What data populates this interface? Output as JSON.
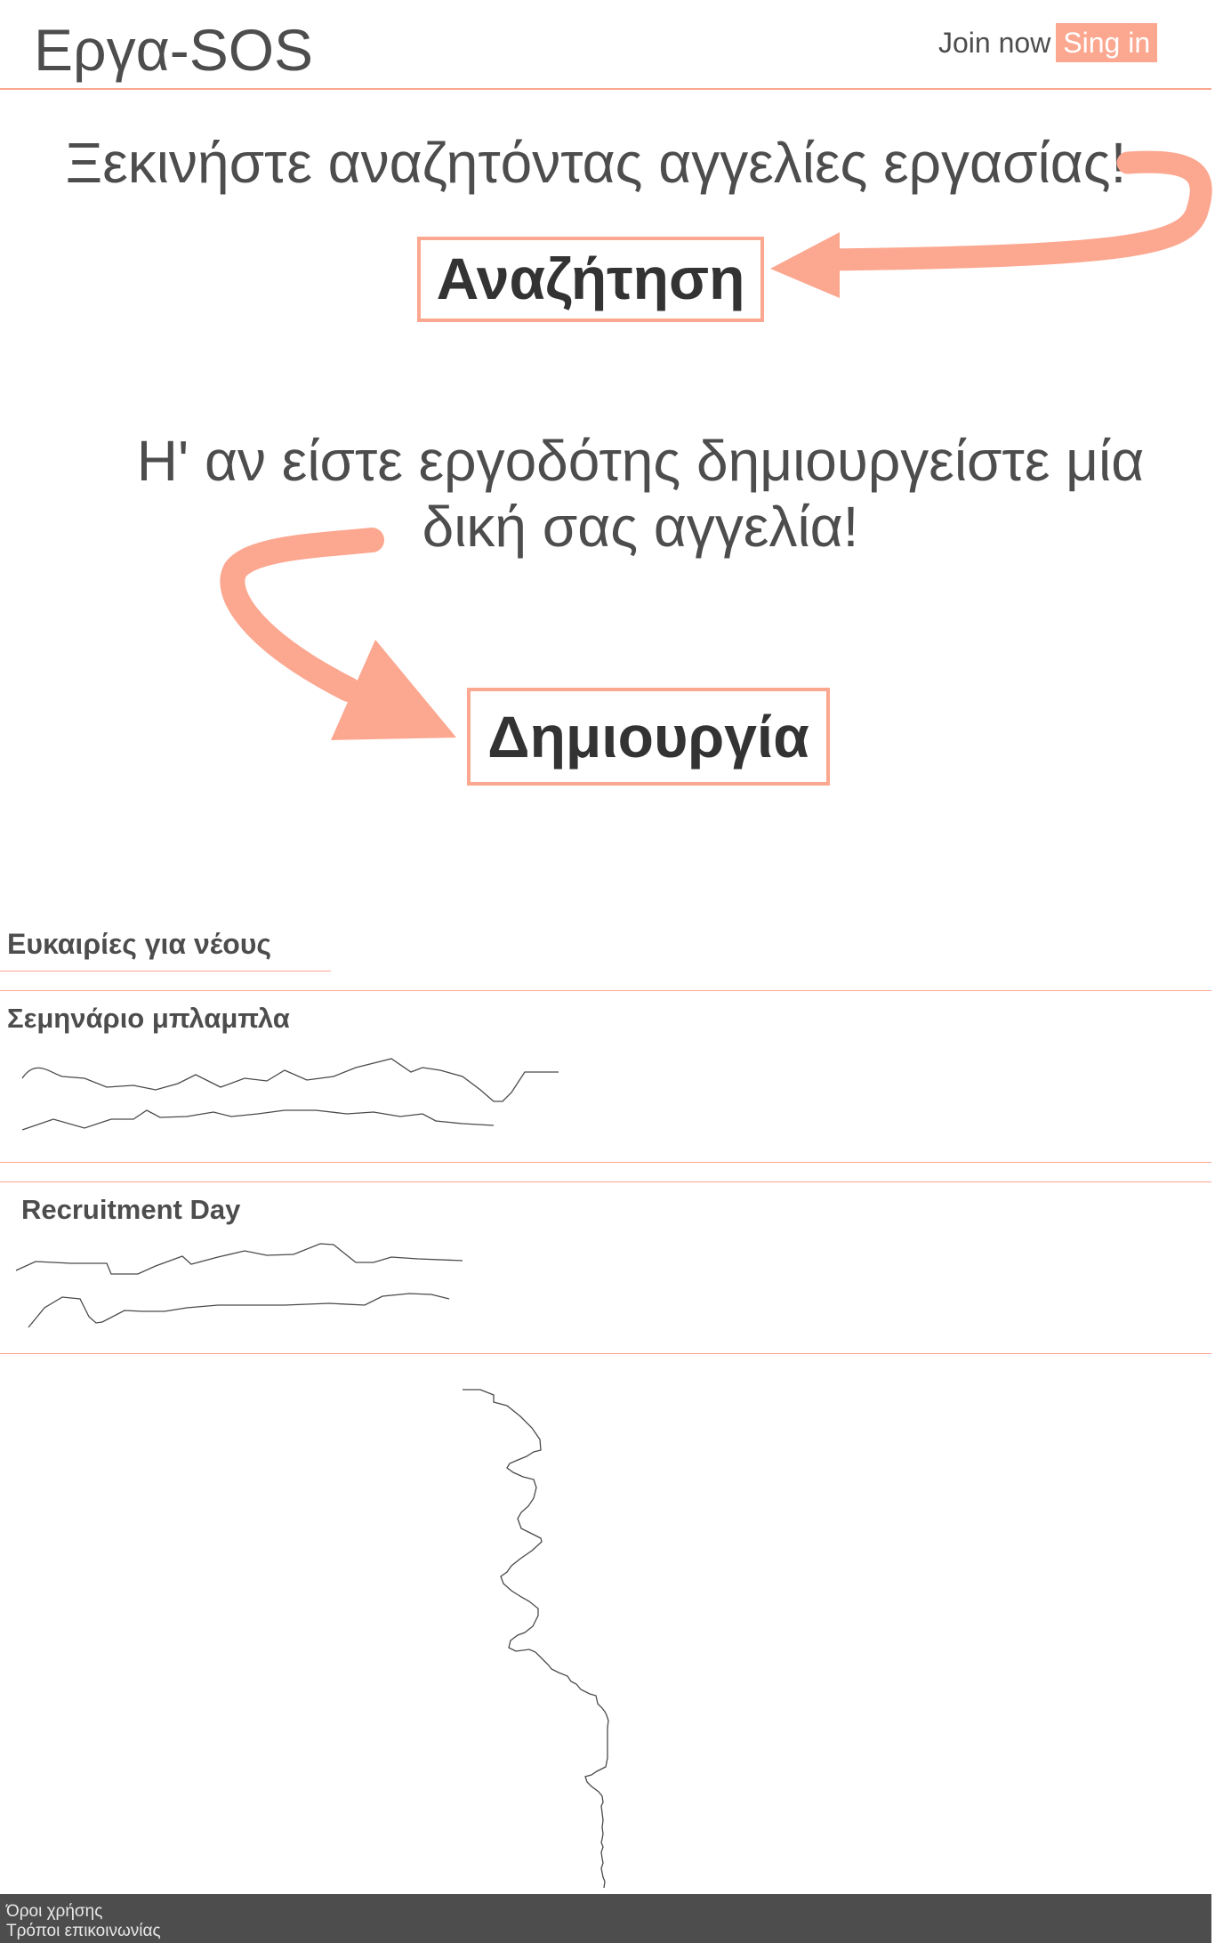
{
  "header": {
    "brand": "Εργα-SOS",
    "join_label": "Join now",
    "signin_label": "Sing in"
  },
  "hero": {
    "search_prompt": "Ξεκινήστε αναζητόντας αγγελίες εργασίας!",
    "search_button": "Αναζήτηση",
    "create_prompt": "Η' αν είστε εργοδότης δημιουργείστε μία δική σας αγγελία!",
    "create_button": "Δημιουργία"
  },
  "section": {
    "title": "Ευκαιρίες για νέους",
    "items": [
      {
        "title": "Σεμηνάριο μπλαμπλα"
      },
      {
        "title": "Recruitment Day"
      }
    ]
  },
  "footer": {
    "terms": "Όροι χρήσης",
    "contact": "Τρόποι επικοινωνίας"
  },
  "colors": {
    "accent": "#fca78f",
    "text": "#4d4d4d",
    "footer_bg": "#4d4d4d"
  },
  "icons": [
    "arrow-to-search-icon",
    "arrow-to-create-icon"
  ]
}
